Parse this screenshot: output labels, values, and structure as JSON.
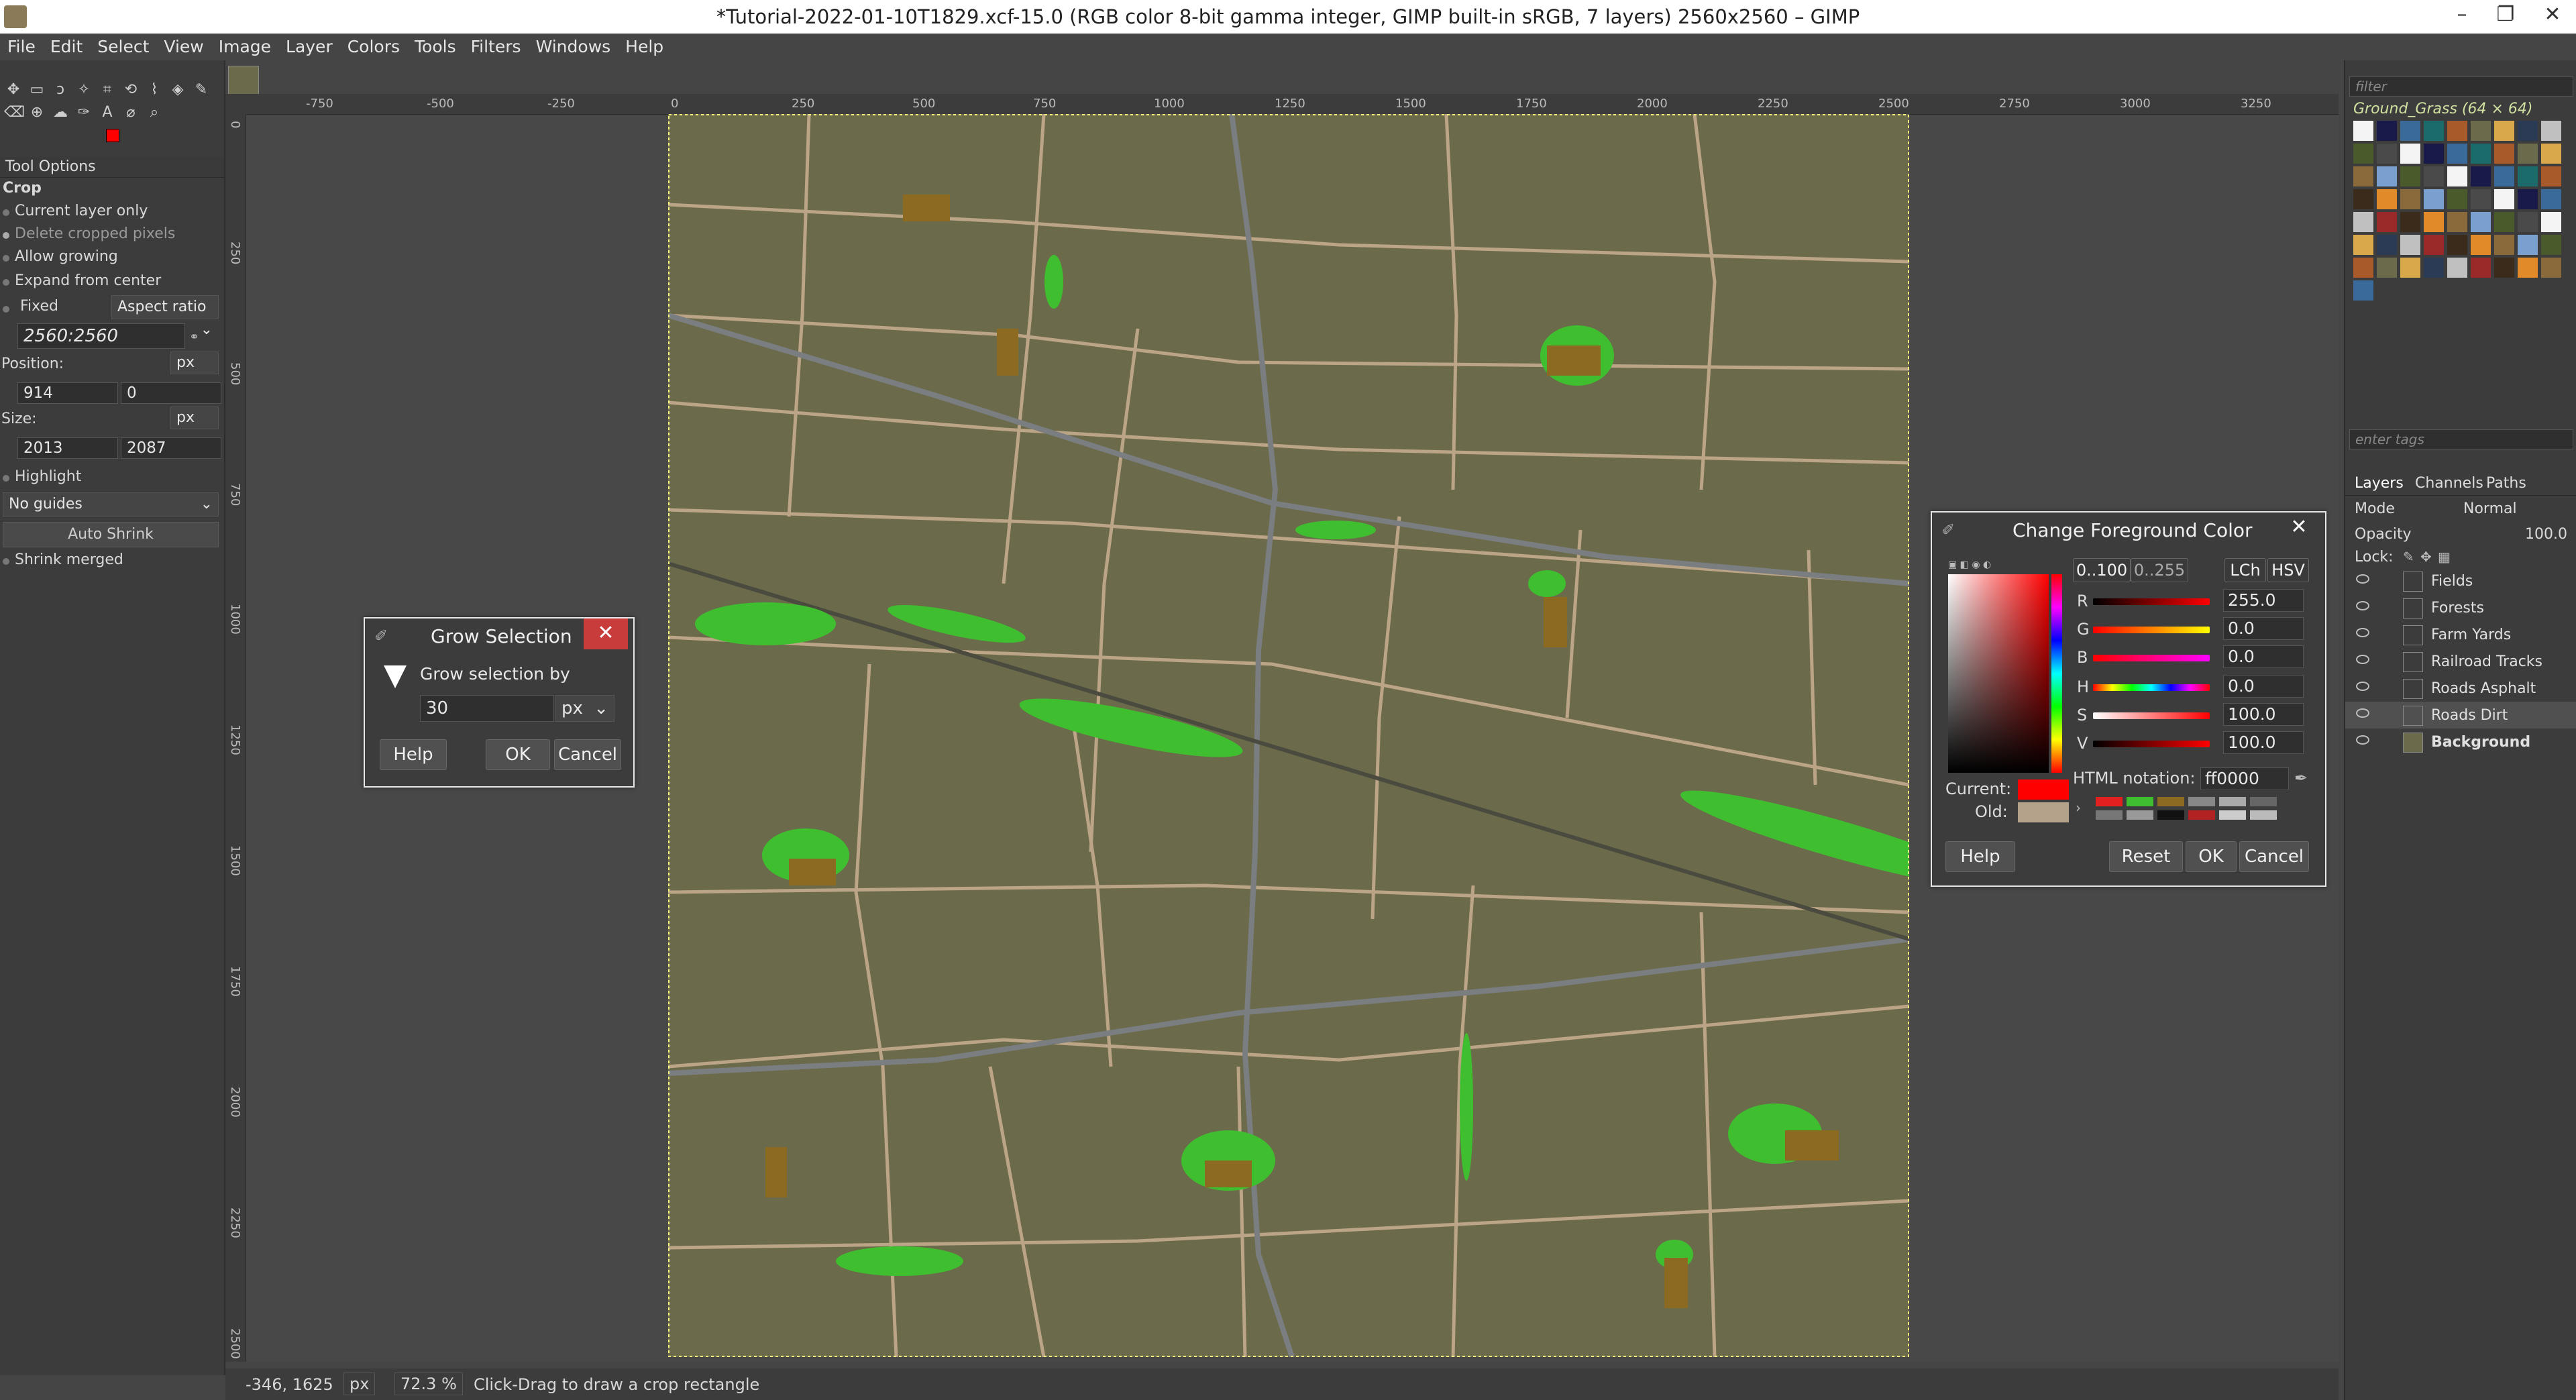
{
  "window": {
    "title": "*Tutorial-2022-01-10T1829.xcf-15.0 (RGB color 8-bit gamma integer, GIMP built-in sRGB, 7 layers) 2560x2560 – GIMP",
    "minimize": "–",
    "restore": "❐",
    "close": "✕"
  },
  "menu": [
    "File",
    "Edit",
    "Select",
    "View",
    "Image",
    "Layer",
    "Colors",
    "Tools",
    "Filters",
    "Windows",
    "Help"
  ],
  "tool_options": {
    "header": "Tool Options",
    "tool_name": "Crop",
    "current_layer_only": "Current layer only",
    "delete_cropped": "Delete cropped pixels",
    "allow_growing": "Allow growing",
    "expand_from_center": "Expand from center",
    "fixed": "Fixed",
    "aspect_ratio": "Aspect ratio",
    "ratio_value": "2560:2560",
    "position_label": "Position:",
    "position_unit": "px",
    "position_x": "914",
    "position_y": "0",
    "size_label": "Size:",
    "size_unit": "px",
    "size_w": "2013",
    "size_h": "2087",
    "highlight": "Highlight",
    "guides": "No guides",
    "auto_shrink": "Auto Shrink",
    "shrink_merged": "Shrink merged"
  },
  "rulers": {
    "h": [
      "-750",
      "-500",
      "-250",
      "0",
      "250",
      "500",
      "750",
      "1000",
      "1250",
      "1500",
      "1750",
      "2000",
      "2250",
      "2500",
      "2750",
      "3000",
      "3250"
    ],
    "v": [
      "0",
      "250",
      "500",
      "750",
      "1000",
      "1250",
      "1500",
      "1750",
      "2000",
      "2250",
      "2500"
    ]
  },
  "status": {
    "coords": "-346, 1625",
    "unit": "px",
    "zoom": "72.3 %",
    "message": "Click-Drag to draw a crop rectangle"
  },
  "brushes": {
    "filter_placeholder": "filter",
    "selected": "Ground_Grass (64 × 64)",
    "tags_placeholder": "enter tags"
  },
  "layers_panel": {
    "tabs": [
      "Layers",
      "Channels",
      "Paths"
    ],
    "mode_label": "Mode",
    "mode_value": "Normal",
    "opacity_label": "Opacity",
    "opacity_value": "100.0",
    "lock_label": "Lock:",
    "layers": [
      {
        "name": "Fields"
      },
      {
        "name": "Forests"
      },
      {
        "name": "Farm Yards"
      },
      {
        "name": "Railroad Tracks"
      },
      {
        "name": "Roads Asphalt"
      },
      {
        "name": "Roads Dirt"
      },
      {
        "name": "Background"
      }
    ]
  },
  "grow_dialog": {
    "title": "Grow Selection",
    "label": "Grow selection by",
    "value": "30",
    "unit": "px",
    "help": "Help",
    "ok": "OK",
    "cancel": "Cancel",
    "close": "✕"
  },
  "color_dialog": {
    "title": "Change Foreground Color",
    "range_100": "0..100",
    "range_255": "0..255",
    "lch": "LCh",
    "hsv": "HSV",
    "channels": [
      {
        "label": "R",
        "value": "255.0"
      },
      {
        "label": "G",
        "value": "0.0"
      },
      {
        "label": "B",
        "value": "0.0"
      },
      {
        "label": "H",
        "value": "0.0"
      },
      {
        "label": "S",
        "value": "100.0"
      },
      {
        "label": "V",
        "value": "100.0"
      }
    ],
    "current_label": "Current:",
    "old_label": "Old:",
    "html_label": "HTML notation:",
    "html_value": "ff0000",
    "help": "Help",
    "reset": "Reset",
    "ok": "OK",
    "cancel": "Cancel",
    "close": "✕",
    "current_color": "#ff0000",
    "old_color": "#b5a28a"
  },
  "colors": {
    "map_bg": "#6b6b4c",
    "dirt_road": "#bca486",
    "asphalt": "#7a7e80",
    "forest": "#3fbf2f",
    "farmyard": "#8c6a22",
    "rail": "#4a4a3e"
  }
}
